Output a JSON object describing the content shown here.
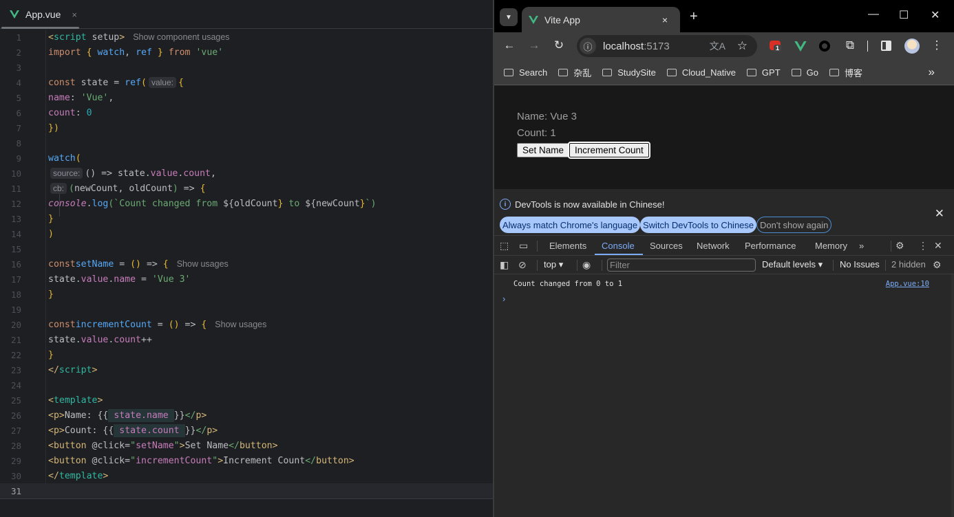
{
  "ide": {
    "tab": {
      "label": "App.vue",
      "close": "×"
    },
    "lines": [
      {
        "n": "1"
      },
      {
        "n": "2"
      },
      {
        "n": "3"
      },
      {
        "n": "4"
      },
      {
        "n": "5"
      },
      {
        "n": "6"
      },
      {
        "n": "7"
      },
      {
        "n": "8"
      },
      {
        "n": "9"
      },
      {
        "n": "10"
      },
      {
        "n": "11"
      },
      {
        "n": "12"
      },
      {
        "n": "13"
      },
      {
        "n": "14"
      },
      {
        "n": "15"
      },
      {
        "n": "16"
      },
      {
        "n": "17"
      },
      {
        "n": "18"
      },
      {
        "n": "19"
      },
      {
        "n": "20"
      },
      {
        "n": "21"
      },
      {
        "n": "22"
      },
      {
        "n": "23"
      },
      {
        "n": "24"
      },
      {
        "n": "25"
      },
      {
        "n": "26"
      },
      {
        "n": "27"
      },
      {
        "n": "28"
      },
      {
        "n": "29"
      },
      {
        "n": "30"
      },
      {
        "n": "31"
      }
    ],
    "code": {
      "l1": {
        "open": "<",
        "tag": "script",
        "attr": " setup",
        "close": ">",
        "hint": "Show component usages"
      },
      "l2": {
        "import": "import",
        "ob": " { ",
        "watch": "watch",
        "comma": ", ",
        "ref": "ref",
        "cb": " } ",
        "from": "from",
        "sp": " ",
        "mod": "'vue'"
      },
      "l4": {
        "const": "const",
        "name": " state = ",
        "ref": "ref",
        "paren": "(",
        "inlay": "value:",
        "brace": "{"
      },
      "l5": {
        "key": "name",
        "colon": ": ",
        "val": "'Vue'",
        "comma": ","
      },
      "l6": {
        "key": "count",
        "colon": ": ",
        "val": "0"
      },
      "l7": {
        "text": "})"
      },
      "l9": {
        "fn": "watch",
        "paren": "("
      },
      "l10": {
        "inlay": "source:",
        "arrow": "() => state.",
        "value": "value",
        "dot": ".",
        "count": "count",
        "comma": ","
      },
      "l11": {
        "inlay": "cb:",
        "open": "(",
        "args": "newCount, oldCount",
        "close": ")",
        "arrow": " => ",
        "brace": "{"
      },
      "l12": {
        "console": "console",
        "dot": ".",
        "log": "log",
        "paren": "(",
        "tpl1": "`Count changed from ",
        "d1": "${",
        "v1": "oldCount",
        "e1": "}",
        "tpl2": " to ",
        "d2": "${",
        "v2": "newCount",
        "e2": "}",
        "tpl3": "`",
        "close": ")"
      },
      "l13": {
        "text": "}"
      },
      "l14": {
        "text": ")"
      },
      "l16": {
        "const": "const",
        "name": "setName",
        "eq": " = ",
        "parens": "()",
        "arrow": " => ",
        "brace": "{",
        "hint": "Show usages"
      },
      "l17": {
        "obj": "state.",
        "value": "value",
        "dot": ".",
        "prop": "name",
        "eq": " = ",
        "val": "'Vue 3'"
      },
      "l18": {
        "text": "}"
      },
      "l20": {
        "const": "const",
        "name": "incrementCount",
        "eq": " = ",
        "parens": "()",
        "arrow": " => ",
        "brace": "{",
        "hint": "Show usages"
      },
      "l21": {
        "obj": "state.",
        "value": "value",
        "dot": ".",
        "prop": "count",
        "op": "++"
      },
      "l22": {
        "text": "}"
      },
      "l23": {
        "open": "</",
        "tag": "script",
        "close": ">"
      },
      "l25": {
        "open": "<",
        "tag": "template",
        "close": ">"
      },
      "l26": {
        "o": "<",
        "t": "p",
        "c": ">",
        "text": "Name: {{",
        "expr1": " state.",
        "expr2": "name",
        "expr3": " ",
        "end": "}}",
        "co": "</",
        "ct": "p",
        "cc": ">"
      },
      "l27": {
        "o": "<",
        "t": "p",
        "c": ">",
        "text": "Count: {{",
        "expr1": " state.",
        "expr2": "count",
        "expr3": " ",
        "end": "}}",
        "co": "</",
        "ct": "p",
        "cc": ">"
      },
      "l28": {
        "o": "<",
        "t": "button",
        "attr": " @click=",
        "q1": "\"",
        "handler": "setName",
        "q2": "\"",
        "c": ">",
        "text": "Set Name",
        "co": "</",
        "ct": "button",
        "cc": ">"
      },
      "l29": {
        "o": "<",
        "t": "button",
        "attr": " @click=",
        "q1": "\"",
        "handler": "incrementCount",
        "q2": "\"",
        "c": ">",
        "text": "Increment Count",
        "co": "</",
        "ct": "button",
        "cc": ">"
      },
      "l30": {
        "open": "</",
        "tag": "template",
        "close": ">"
      }
    }
  },
  "browser": {
    "tab_title": "Vite App",
    "tab_close": "×",
    "new_tab": "+",
    "window_controls": {
      "minimize": "—",
      "maximize": "☐",
      "close": "✕"
    },
    "nav": {
      "back": "←",
      "forward": "→",
      "reload": "↻"
    },
    "url": {
      "host": "localhost",
      "port": ":5173"
    },
    "extension_badge": "1",
    "bookmarks": [
      "Search",
      "杂乱",
      "StudySite",
      "Cloud_Native",
      "GPT",
      "Go",
      "博客"
    ],
    "bookmarks_more": "»",
    "page": {
      "name_line": "Name: Vue 3",
      "count_line": "Count: 1",
      "set_name_button": "Set Name",
      "increment_button": "Increment Count"
    },
    "devtools": {
      "infobar": {
        "message": "DevTools is now available in Chinese!",
        "chips": [
          "Always match Chrome's language",
          "Switch DevTools to Chinese",
          "Don't show again"
        ]
      },
      "tabs": [
        "Elements",
        "Console",
        "Sources",
        "Network",
        "Performance",
        "Memory"
      ],
      "active_tab": "Console",
      "more_tabs": "»",
      "console_toolbar": {
        "context": "top",
        "filter_placeholder": "Filter",
        "levels": "Default levels ▾",
        "issues": "No Issues",
        "hidden": "2 hidden"
      },
      "messages": [
        {
          "text": "Count changed from 0 to 1",
          "source": "App.vue:10"
        }
      ],
      "prompt": "›"
    }
  },
  "colors": {
    "vue_green": "#42b883",
    "devtools_accent": "#7cacf8",
    "chip_bg": "#a8c7fa"
  }
}
